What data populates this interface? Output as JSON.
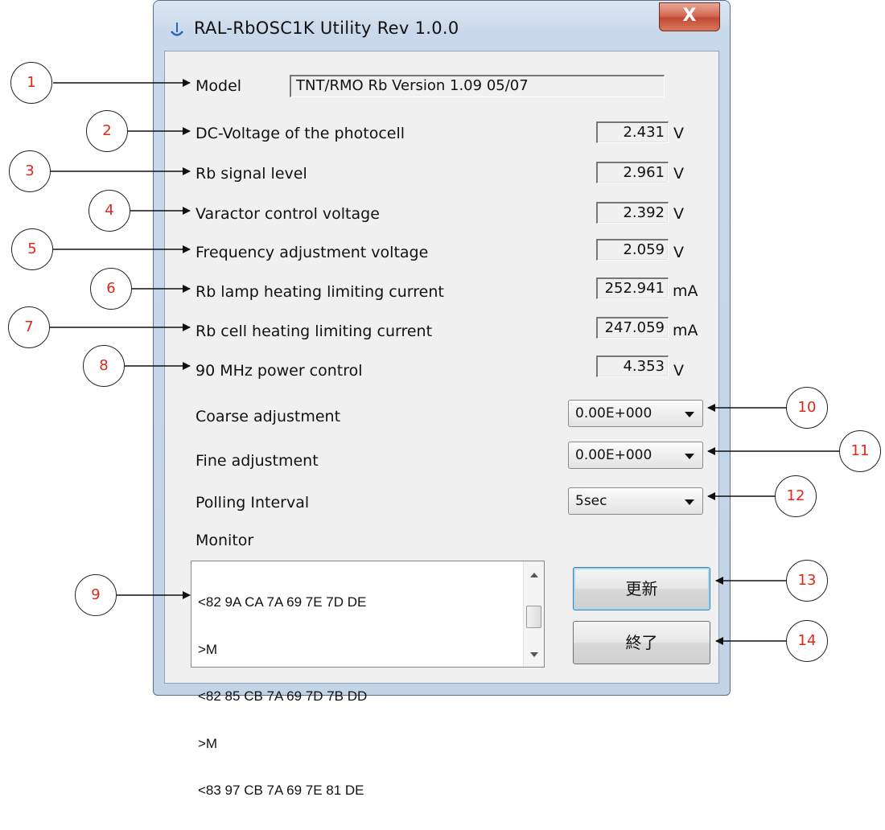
{
  "window": {
    "title": "RAL-RbOSC1K Utility Rev 1.0.0",
    "close_glyph": "X"
  },
  "model": {
    "label": "Model",
    "value": "TNT/RMO Rb  Version 1.09  05/07"
  },
  "readings": [
    {
      "label": "DC-Voltage of the photocell",
      "value": "2.431",
      "unit": "V"
    },
    {
      "label": "Rb signal level",
      "value": "2.961",
      "unit": "V"
    },
    {
      "label": "Varactor control voltage",
      "value": "2.392",
      "unit": "V"
    },
    {
      "label": "Frequency adjustment voltage",
      "value": "2.059",
      "unit": "V"
    },
    {
      "label": "Rb lamp heating limiting current",
      "value": "252.941",
      "unit": "mA"
    },
    {
      "label": "Rb cell heating limiting current",
      "value": "247.059",
      "unit": "mA"
    },
    {
      "label": "90 MHz power control",
      "value": "4.353",
      "unit": "V"
    }
  ],
  "controls": {
    "coarse": {
      "label": "Coarse adjustment",
      "value": "0.00E+000"
    },
    "fine": {
      "label": "Fine adjustment",
      "value": "0.00E+000"
    },
    "polling": {
      "label": "Polling Interval",
      "value": "5sec"
    }
  },
  "monitor": {
    "label": "Monitor",
    "lines": [
      "<82 9A CA 7A 69 7E 7D DE",
      ">M",
      "<82 85 CB 7A 69 7D 7B DD",
      ">M",
      "<83 97 CB 7A 69 7E 81 DE"
    ]
  },
  "buttons": {
    "update": "更新",
    "exit": "終了"
  },
  "callouts": [
    "1",
    "2",
    "3",
    "4",
    "5",
    "6",
    "7",
    "8",
    "9",
    "10",
    "11",
    "12",
    "13",
    "14"
  ],
  "colors": {
    "callout_text": "#e0251b"
  }
}
